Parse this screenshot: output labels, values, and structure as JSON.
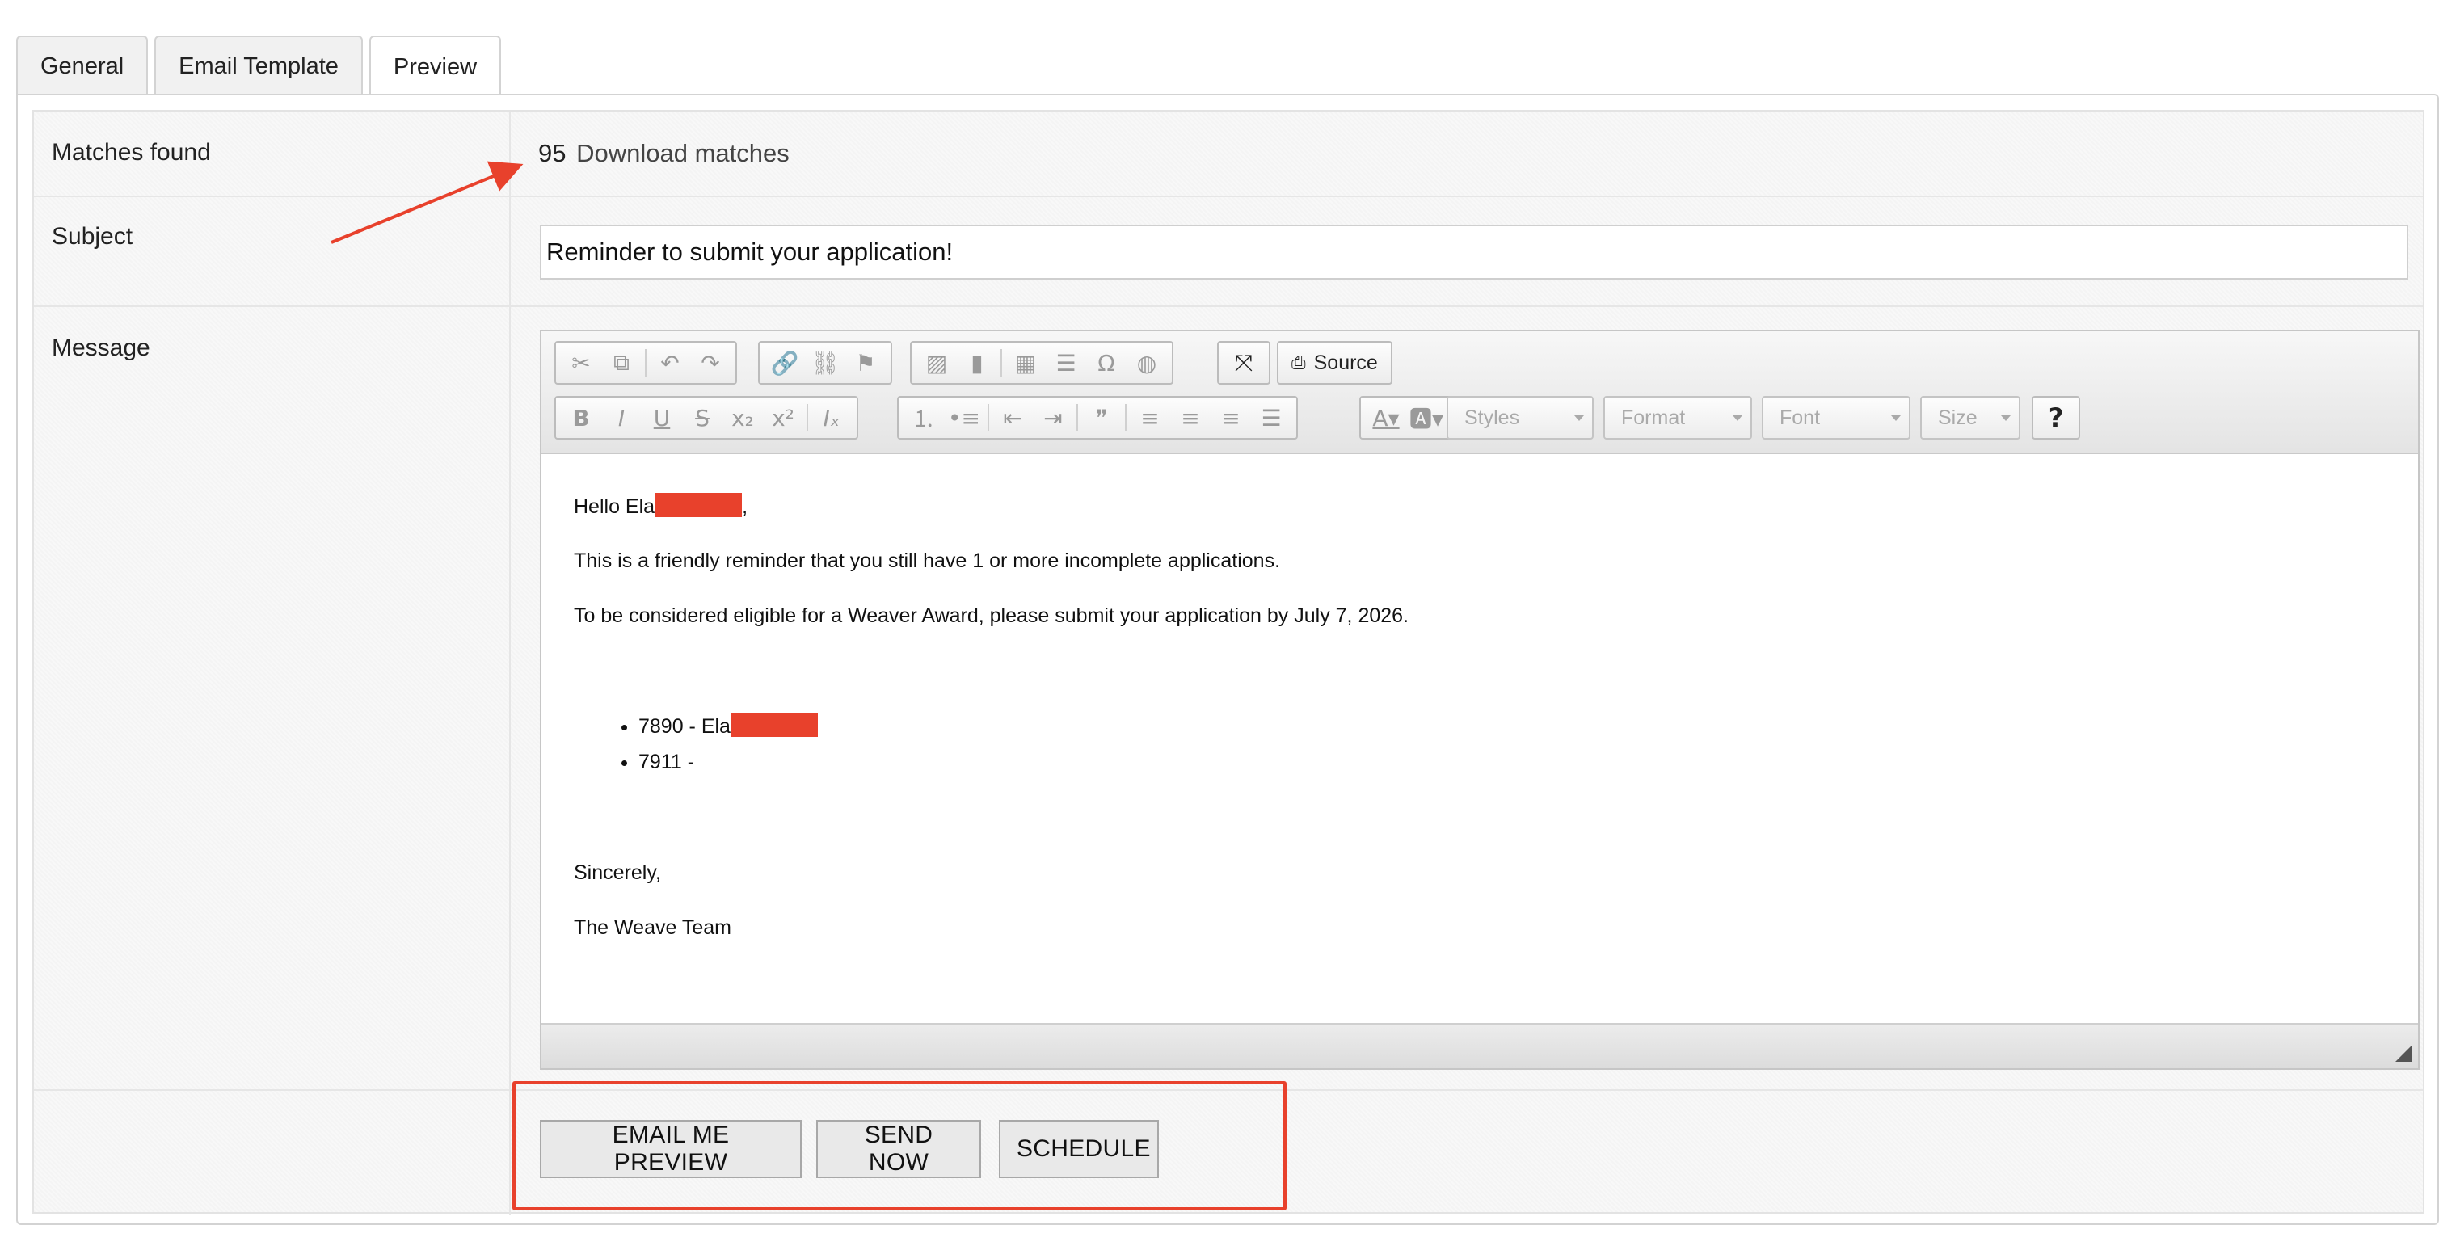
{
  "tabs": [
    {
      "label": "General",
      "active": false
    },
    {
      "label": "Email Template",
      "active": false
    },
    {
      "label": "Preview",
      "active": true
    }
  ],
  "matches": {
    "label": "Matches found",
    "count": "95",
    "link": "Download matches"
  },
  "subject": {
    "label": "Subject",
    "value": "Reminder to submit your application!"
  },
  "message": {
    "label": "Message",
    "toolbar": {
      "source_label": "Source",
      "styles": "Styles",
      "format": "Format",
      "font": "Font",
      "size": "Size",
      "help": "?"
    },
    "body": {
      "greeting_prefix": "Hello Ela",
      "greeting_suffix": ",",
      "line1": "This is a friendly reminder that you still have 1 or more incomplete applications.",
      "line2": "To be considered eligible for a Weaver Award, please submit your application by July 7, 2026.",
      "items": [
        "7890 - Ela",
        "7911 -"
      ],
      "closing": "Sincerely,",
      "signature": "The Weave Team"
    }
  },
  "actions": {
    "email_preview": "EMAIL ME PREVIEW",
    "send_now": "SEND NOW",
    "schedule": "SCHEDULE"
  },
  "colors": {
    "annotation": "#e8412c",
    "redaction": "#e8412c"
  },
  "icons": [
    "cut-icon",
    "copy-icon",
    "undo-icon",
    "redo-icon",
    "link-icon",
    "unlink-icon",
    "anchor-icon",
    "image-icon",
    "flash-icon",
    "table-icon",
    "horizontal-line-icon",
    "omega-icon",
    "iframe-icon",
    "maximize-icon",
    "source-icon",
    "bold-icon",
    "italic-icon",
    "underline-icon",
    "strikethrough-icon",
    "subscript-icon",
    "superscript-icon",
    "remove-format-icon",
    "numbered-list-icon",
    "bulleted-list-icon",
    "outdent-icon",
    "indent-icon",
    "blockquote-icon",
    "align-left-icon",
    "align-center-icon",
    "align-right-icon",
    "justify-icon",
    "text-color-icon",
    "background-color-icon"
  ]
}
